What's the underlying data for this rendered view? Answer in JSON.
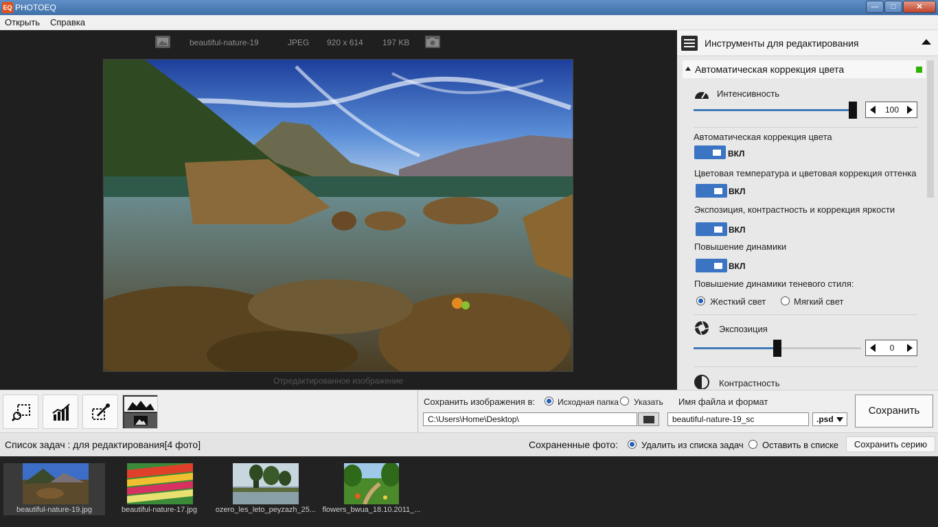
{
  "window": {
    "title": "PHOTOEQ",
    "app_icon": "EQ"
  },
  "menu": {
    "open": "Открыть",
    "help": "Справка"
  },
  "image_info": {
    "name": "beautiful-nature-19",
    "format": "JPEG",
    "dimensions": "920 x 614",
    "size": "197 KB"
  },
  "viewer": {
    "caption": "Отредактированное изображение"
  },
  "panel": {
    "title": "Инструменты для редактирования",
    "section_title": "Автоматическая коррекция цвета",
    "section_status_color": "#2cb200",
    "intensity": {
      "label": "Интенсивность",
      "value": "100",
      "level_percent": 100
    },
    "auto_color": {
      "label": "Автоматическая коррекция цвета",
      "state": "ВКЛ"
    },
    "color_temp": {
      "label": "Цветовая температура и цветовая коррекция оттенка",
      "state": "ВКЛ"
    },
    "exposure_contrast": {
      "label": "Экспозиция, контрастность  и коррекция яркости",
      "state": "ВКЛ"
    },
    "dynamics": {
      "label": "Повышение динамики",
      "state": "ВКЛ"
    },
    "shadow_style": {
      "label": "Повышение динамики теневого стиля:",
      "hard": "Жесткий свет",
      "soft": "Мягкий свет",
      "selected": "hard"
    },
    "exposure": {
      "label": "Экспозиция",
      "value": "0",
      "level_percent": 50
    },
    "contrast": {
      "label": "Контрастность"
    },
    "accent_color": "#3f79b8"
  },
  "toolbar": {
    "tools": [
      "crop-zoom",
      "levels-chart",
      "eyedropper",
      "compare-view"
    ]
  },
  "save": {
    "label": "Сохранить изображения в:",
    "source_folder": "Исходная папка",
    "specify": "Указать",
    "selected": "source_folder",
    "path": "C:\\Users\\Home\\Desktop\\",
    "filename_label": "Имя файла и формат",
    "filename": "beautiful-nature-19_sc",
    "format": ".psd",
    "save_button": "Сохранить"
  },
  "tasks": {
    "title": "Список задач : для редактирования[4 фото]",
    "saved_label": "Сохраненные фото:",
    "remove_option": "Удалить из списка задач",
    "keep_option": "Оставить в списке",
    "selected": "remove",
    "save_series_button": "Сохранить серию",
    "thumbnails": [
      {
        "name": "beautiful-nature-19.jpg",
        "selected": true
      },
      {
        "name": "beautiful-nature-17.jpg",
        "selected": false
      },
      {
        "name": "ozero_les_leto_peyzazh_25...",
        "selected": false
      },
      {
        "name": "flowers_bwua_18.10.2011_...",
        "selected": false
      }
    ]
  }
}
